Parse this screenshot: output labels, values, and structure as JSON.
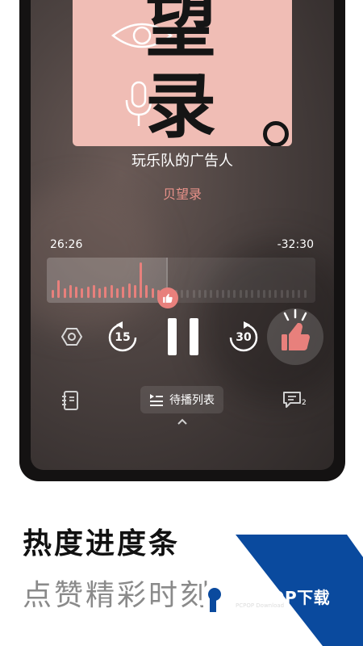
{
  "player": {
    "track_title": "玩乐队的广告人",
    "author": "贝望录",
    "elapsed": "26:26",
    "remaining": "-32:30",
    "progress_fraction": 0.44,
    "rewind_seconds": "15",
    "forward_seconds": "30",
    "queue_label": "待播列表",
    "comment_count": "2"
  },
  "cover": {
    "char_top": "望",
    "char_bottom": "录",
    "background": "#f0bdb5"
  },
  "promo": {
    "heading": "热度进度条",
    "subheading": "点赞精彩时刻"
  },
  "watermark": {
    "brand": "PCPOP下载",
    "sub": "PCPOP Download"
  },
  "colors": {
    "accent": "#e8807c",
    "promo_blue": "#0a4a9e"
  },
  "icons": [
    "hexagon-settings-icon",
    "rewind-15-icon",
    "pause-icon",
    "forward-30-icon",
    "thumbs-up-icon",
    "notebook-icon",
    "playlist-icon",
    "comment-icon",
    "chevron-up-icon"
  ]
}
